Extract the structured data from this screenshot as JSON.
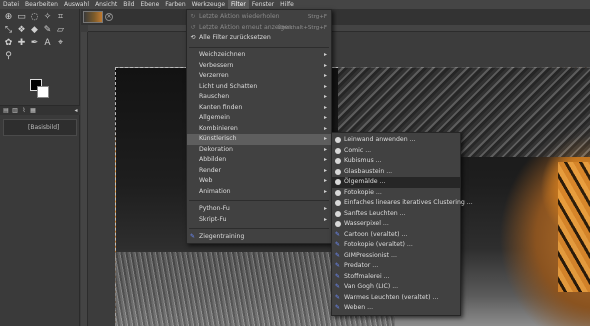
{
  "menubar": {
    "items": [
      "Datei",
      "Bearbeiten",
      "Auswahl",
      "Ansicht",
      "Bild",
      "Ebene",
      "Farben",
      "Werkzeuge",
      "Filter",
      "Fenster",
      "Hilfe"
    ],
    "active": "Filter"
  },
  "layers": {
    "layer_name": "[Basisbild]"
  },
  "filter_menu": {
    "items": [
      {
        "label": "Letzte Aktion wiederholen",
        "accel": "Strg+F",
        "disabled": true
      },
      {
        "label": "Letzte Aktion erneut anzeigen",
        "accel": "Umschalt+Strg+F",
        "disabled": true
      },
      {
        "label": "Alle Filter zurücksetzen"
      },
      {
        "label": "Weichzeichnen"
      },
      {
        "label": "Verbessern"
      },
      {
        "label": "Verzerren"
      },
      {
        "label": "Licht und Schatten"
      },
      {
        "label": "Rauschen"
      },
      {
        "label": "Kanten finden"
      },
      {
        "label": "Allgemein"
      },
      {
        "label": "Kombinieren"
      },
      {
        "label": "Künstlerisch"
      },
      {
        "label": "Dekoration"
      },
      {
        "label": "Abbilden"
      },
      {
        "label": "Render"
      },
      {
        "label": "Web"
      },
      {
        "label": "Animation"
      },
      {
        "label": "Python-Fu"
      },
      {
        "label": "Skript-Fu"
      },
      {
        "label": "Ziegentraining"
      }
    ]
  },
  "submenu": {
    "items": [
      {
        "label": "Leinwand anwenden ...",
        "icon": "gegl-icon"
      },
      {
        "label": "Comic ...",
        "icon": "gegl-icon"
      },
      {
        "label": "Kubismus ...",
        "icon": "gegl-icon"
      },
      {
        "label": "Glasbaustein ...",
        "icon": "gegl-icon"
      },
      {
        "label": "Ölgemälde ...",
        "icon": "gegl-icon"
      },
      {
        "label": "Fotokopie ...",
        "icon": "gegl-icon"
      },
      {
        "label": "Einfaches lineares iteratives Clustering ...",
        "icon": "gegl-icon"
      },
      {
        "label": "Sanftes Leuchten ...",
        "icon": "gegl-icon"
      },
      {
        "label": "Wasserpixel ...",
        "icon": "gegl-icon"
      },
      {
        "label": "Cartoon (veraltet) ...",
        "icon": "plugin-icon"
      },
      {
        "label": "Fotokopie (veraltet) ...",
        "icon": "plugin-icon"
      },
      {
        "label": "GIMPressionist ...",
        "icon": "plugin-icon"
      },
      {
        "label": "Predator ...",
        "icon": "plugin-icon"
      },
      {
        "label": "Stoffmalerei ...",
        "icon": "plugin-icon"
      },
      {
        "label": "Van Gogh (LIC) ...",
        "icon": "plugin-icon"
      },
      {
        "label": "Warmes Leuchten (veraltet) ...",
        "icon": "plugin-icon"
      },
      {
        "label": "Weben ...",
        "icon": "plugin-icon"
      }
    ]
  }
}
